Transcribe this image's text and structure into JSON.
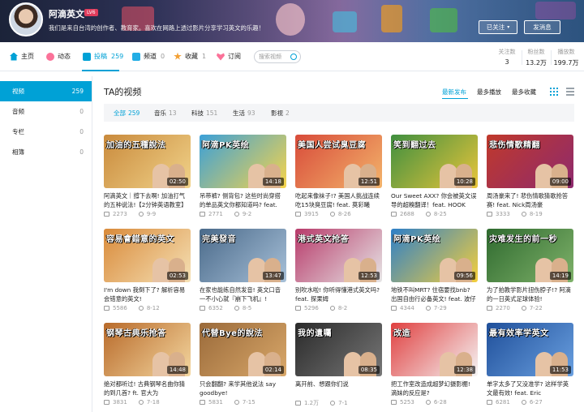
{
  "channel": {
    "name": "阿滴英文",
    "level": "LV6",
    "description": "我们是来自台湾的创作者、教育家。喜欢在网路上透过影片分享学习英文的乐趣！",
    "follow_label": "已关注",
    "message_label": "发消息"
  },
  "nav": {
    "items": [
      {
        "label": "主页",
        "count": "",
        "icon": "home-icon",
        "color": "#00a1d6"
      },
      {
        "label": "动态",
        "count": "",
        "icon": "dynamic-icon",
        "color": "#fb7299"
      },
      {
        "label": "投稿",
        "count": "259",
        "icon": "video-icon",
        "color": "#00a1d6"
      },
      {
        "label": "频道",
        "count": "0",
        "icon": "channel-icon",
        "color": "#23ade5"
      },
      {
        "label": "收藏",
        "count": "1",
        "icon": "favorite-icon",
        "color": "#f3a034"
      },
      {
        "label": "订阅",
        "count": "",
        "icon": "subscribe-icon",
        "color": "#fb7299"
      }
    ],
    "search_placeholder": "搜索视频"
  },
  "stats": [
    {
      "label": "关注数",
      "value": "3"
    },
    {
      "label": "粉丝数",
      "value": "13.2万"
    },
    {
      "label": "播放数",
      "value": "199.7万"
    }
  ],
  "sidebar": [
    {
      "label": "视频",
      "count": "259"
    },
    {
      "label": "音频",
      "count": "0"
    },
    {
      "label": "专栏",
      "count": "0"
    },
    {
      "label": "相簿",
      "count": "0"
    }
  ],
  "main": {
    "title": "TA的视频",
    "sort_tabs": [
      "最新发布",
      "最多播放",
      "最多收藏"
    ],
    "filters": [
      {
        "label": "全部",
        "count": "259"
      },
      {
        "label": "音乐",
        "count": "13"
      },
      {
        "label": "科技",
        "count": "151"
      },
      {
        "label": "生活",
        "count": "93"
      },
      {
        "label": "影视",
        "count": "2"
      }
    ]
  },
  "videos": [
    {
      "thumb_text": "加油的五種說法",
      "duration": "02:50",
      "title": "阿滴英文｜撐下去啊! 加油打气的五种说法!【2分钟英语教室】",
      "plays": "2273",
      "date": "9-9",
      "bg": "#c98a3c",
      "bg2": "#f1d38a"
    },
    {
      "thumb_text": "阿滴PK英绘",
      "duration": "14:18",
      "title": "吊带裤? 侧背包? 这些时尚穿搭的单品英文你都知道吗? feat.",
      "plays": "2771",
      "date": "9-2",
      "bg": "#3ba0d8",
      "bg2": "#f7d44a"
    },
    {
      "thumb_text": "美国人尝试臭豆腐",
      "duration": "12:51",
      "title": "吃起来像袜子!? 美国人挑战连续吃15块臭豆腐! feat. 莫彩曦",
      "plays": "3915",
      "date": "8-26",
      "bg": "#d84b3a",
      "bg2": "#f3b46b"
    },
    {
      "thumb_text": "笑到翻过去",
      "duration": "10:28",
      "title": "Our Sweet AXX? 你会被英文误导的超糗翻译！feat. HOOK",
      "plays": "2688",
      "date": "8-25",
      "bg": "#3f8f3f",
      "bg2": "#e9c53b"
    },
    {
      "thumb_text": "悲伤情歌精翻",
      "duration": "09:00",
      "title": "周汤豪来了! 悲伤情歌猜歌抢答赛! feat. Nick周汤豪",
      "plays": "3333",
      "date": "8-19",
      "bg": "#c0392b",
      "bg2": "#8e2a6e"
    },
    {
      "thumb_text": "容易會錯意的英文",
      "duration": "02:53",
      "title": "I'm down 我倒下了? 解析容易会错意的英文!",
      "plays": "5586",
      "date": "8-12",
      "bg": "#d98a3a",
      "bg2": "#f5e1b5"
    },
    {
      "thumb_text": "完美發音",
      "duration": "13:47",
      "title": "在家也能练自然发音! 英文口音一不小心就『崩下飞机』!",
      "plays": "6352",
      "date": "8-5",
      "bg": "#4a6a8a",
      "bg2": "#a7c0d8"
    },
    {
      "thumb_text": "港式英文抢答",
      "duration": "12:53",
      "title": "别吹水啦! 你听得懂港式英文吗? feat. 探果姆",
      "plays": "5296",
      "date": "8-2",
      "bg": "#b83a6a",
      "bg2": "#e6e6e6"
    },
    {
      "thumb_text": "阿滴PK英绘",
      "duration": "09:56",
      "title": "地铁不叫MRT? 住宿要找bnb? 出国自由行必备英文! feat. 波仔",
      "plays": "4344",
      "date": "7-29",
      "bg": "#2d7fc8",
      "bg2": "#f5cf3b"
    },
    {
      "thumb_text": "灾难发生的前一秒",
      "duration": "14:19",
      "title": "为了拍教学影片扭伤脖子!? 阿滴的一日英式足球体验!",
      "plays": "2270",
      "date": "7-22",
      "bg": "#2f6a2f",
      "bg2": "#7fb26a"
    },
    {
      "thumb_text": "钢琴古典乐抢答",
      "duration": "14:48",
      "title": "绝对都听过! 古典钢琴名曲你猜的到几首? ft. 官大为",
      "plays": "3831",
      "date": "7-18",
      "bg": "#b86a2a",
      "bg2": "#f4d7a0"
    },
    {
      "thumb_text": "代替Bye的說法",
      "duration": "02:14",
      "title": "只会翻翻? 来学其他说法 say goodbye!",
      "plays": "5831",
      "date": "7-15",
      "bg": "#9a6a3a",
      "bg2": "#d9a86a"
    },
    {
      "thumb_text": "我的遺囑",
      "duration": "08:35",
      "title": "离开前、想跟你们说",
      "plays": "1.2万",
      "date": "7-1",
      "bg": "#2a2a2a",
      "bg2": "#777777"
    },
    {
      "thumb_text": "改造",
      "duration": "12:38",
      "title": "把工作室改造成超梦幻摄影棚! 滴妹的反应是?",
      "plays": "5253",
      "date": "6-28",
      "bg": "#e04040",
      "bg2": "#f5f5f5"
    },
    {
      "thumb_text": "最有效率学英文",
      "duration": "11:53",
      "title": "单字太多了又没准学? 这样学英文最有效! feat. Eric",
      "plays": "6281",
      "date": "6-27",
      "bg": "#1f4f9a",
      "bg2": "#6aa0e0"
    }
  ]
}
